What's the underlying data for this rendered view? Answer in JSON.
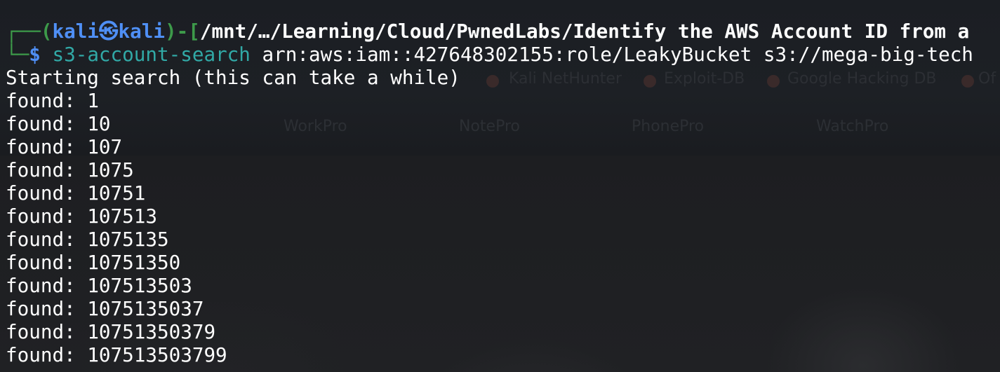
{
  "prompt": {
    "corner_top": "┌──",
    "paren_open": "(",
    "user": "kali",
    "skull": "㉿",
    "host": "kali",
    "paren_close": ")-[",
    "path": "/mnt/…/Learning/Cloud/PwnedLabs/Identify the AWS Account ID from a",
    "corner_bottom": "└─",
    "dollar": "$"
  },
  "command": {
    "name": "s3-account-search",
    "args": "arn:aws:iam::427648302155:role/LeakyBucket s3://mega-big-tech"
  },
  "output": {
    "start_message": "Starting search (this can take a while)",
    "found_label": "found:",
    "found_values": [
      "1",
      "10",
      "107",
      "1075",
      "10751",
      "107513",
      "1075135",
      "10751350",
      "107513503",
      "1075135037",
      "10751350379",
      "107513503799"
    ]
  },
  "background_ghost": {
    "bookmarks": [
      "Kali NetHunter",
      "Exploit-DB",
      "Google Hacking DB",
      "Of"
    ],
    "products": [
      "WorkPro",
      "NotePro",
      "PhonePro",
      "WatchPro"
    ]
  },
  "colors": {
    "background": "#16181c",
    "prompt_green": "#3d9a4a",
    "prompt_blue": "#4f8ff5",
    "command_teal": "#31a9a6",
    "text": "#ffffff"
  }
}
